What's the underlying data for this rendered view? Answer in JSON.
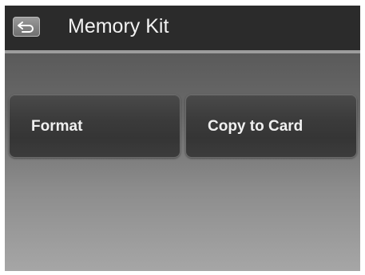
{
  "title_bar": {
    "back_icon": "return-arrow-icon",
    "title": "Memory Kit"
  },
  "menu": {
    "items": [
      {
        "label": "Format"
      },
      {
        "label": "Copy to Card"
      }
    ]
  },
  "colors": {
    "title_bar_bg": "#2b2b2b",
    "divider": "#9d9d9d",
    "button_bg": "#3b3b3b",
    "text": "#f0f0f0"
  }
}
